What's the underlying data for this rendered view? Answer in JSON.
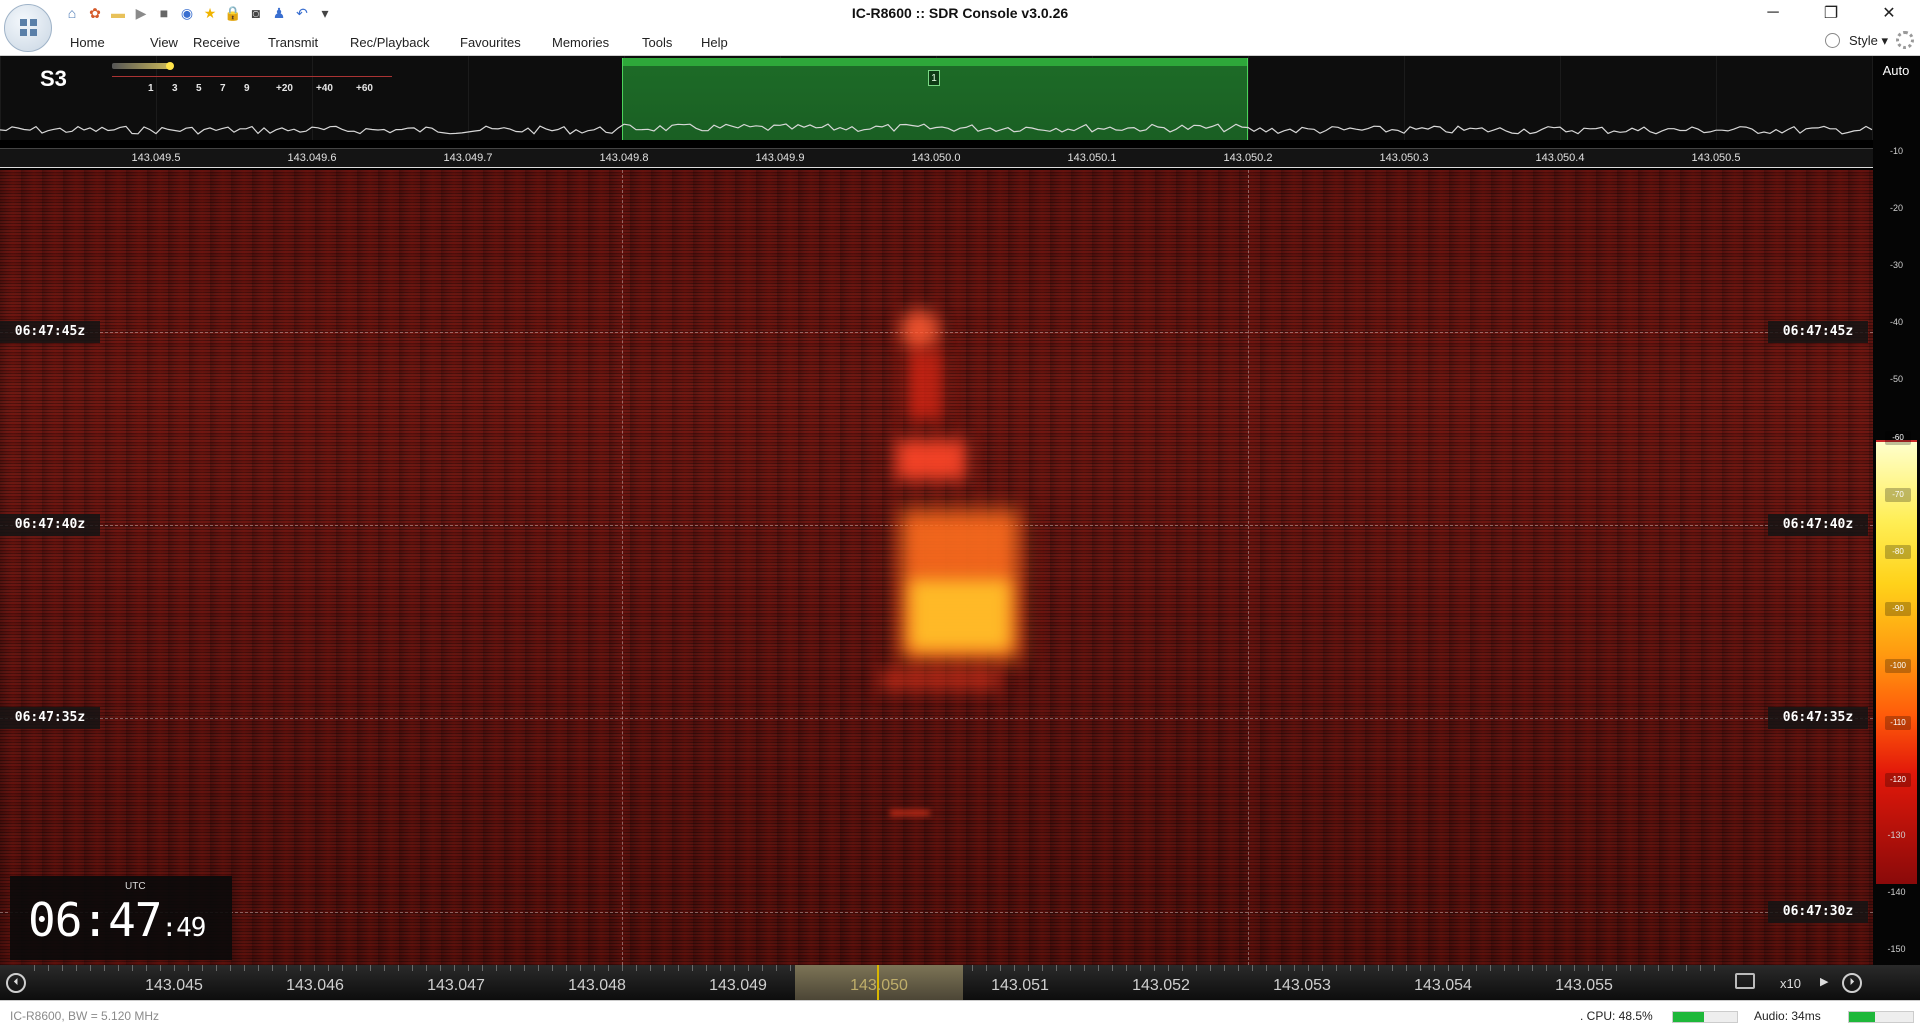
{
  "window": {
    "title": "IC-R8600 :: SDR Console v3.0.26",
    "controls": {
      "minimize": "─",
      "restore": "❐",
      "close": "✕"
    }
  },
  "quick_access": [
    {
      "icon": "home-icon",
      "glyph": "⌂",
      "color": "#4a78b5"
    },
    {
      "icon": "gear-icon",
      "glyph": "✿",
      "color": "#d55a2a"
    },
    {
      "icon": "folder-icon",
      "glyph": "▬",
      "color": "#e8c15a"
    },
    {
      "icon": "play-icon",
      "glyph": "▶",
      "color": "#8a8a8a"
    },
    {
      "icon": "stop-icon",
      "glyph": "■",
      "color": "#666666"
    },
    {
      "icon": "radio-icon",
      "glyph": "◉",
      "color": "#3a6fd0"
    },
    {
      "icon": "star-icon",
      "glyph": "★",
      "color": "#f0b400"
    },
    {
      "icon": "lock-icon",
      "glyph": "🔒",
      "color": "#d9a100"
    },
    {
      "icon": "camera-icon",
      "glyph": "◙",
      "color": "#444444"
    },
    {
      "icon": "user-icon",
      "glyph": "♟",
      "color": "#3a6fd0"
    },
    {
      "icon": "undo-icon",
      "glyph": "↶",
      "color": "#3a6fd0"
    },
    {
      "icon": "customize-icon",
      "glyph": "▾",
      "color": "#444444"
    }
  ],
  "menu": {
    "items": [
      "Home",
      "View",
      "Receive",
      "Transmit",
      "Rec/Playback",
      "Favourites",
      "Memories",
      "Tools",
      "Help"
    ],
    "style_label": "Style"
  },
  "smeter": {
    "reading": "S3",
    "scale": [
      "1",
      "3",
      "5",
      "7",
      "9",
      "+20",
      "+40",
      "+60"
    ]
  },
  "spectrum": {
    "rx_marker": "1",
    "ruler_labels": [
      "143.049.5",
      "143.049.6",
      "143.049.7",
      "143.049.8",
      "143.049.9",
      "143.050.0",
      "143.050.1",
      "143.050.2",
      "143.050.3",
      "143.050.4",
      "143.050.5"
    ],
    "auto_label": "Auto"
  },
  "waterfall": {
    "time_labels": [
      "06:47:45z",
      "06:47:40z",
      "06:47:35z",
      "06:47:30z"
    ]
  },
  "clock": {
    "zone": "UTC",
    "hm": "06:47",
    "sec": ":49"
  },
  "db_scale": {
    "ticks": [
      "-10",
      "-20",
      "-30",
      "-40",
      "-50",
      "-60",
      "-70",
      "-80",
      "-90",
      "-100",
      "-110",
      "-120",
      "-130",
      "-140",
      "-150"
    ]
  },
  "tuning": {
    "labels": [
      "143.045",
      "143.046",
      "143.047",
      "143.048",
      "143.049",
      "143.050",
      "143.051",
      "143.052",
      "143.053",
      "143.054",
      "143.055"
    ],
    "zoom": "x10"
  },
  "status": {
    "radio": "IC-R8600, BW = 5.120 MHz",
    "cpu": ". CPU: 48.5%",
    "cpu_fraction": 0.485,
    "audio": "Audio: 34ms",
    "audio_fraction": 0.4
  },
  "colors": {
    "rx_band": "#2ea83a",
    "signal_core": "#ffb21a",
    "waterfall_base": "#5a1410"
  }
}
